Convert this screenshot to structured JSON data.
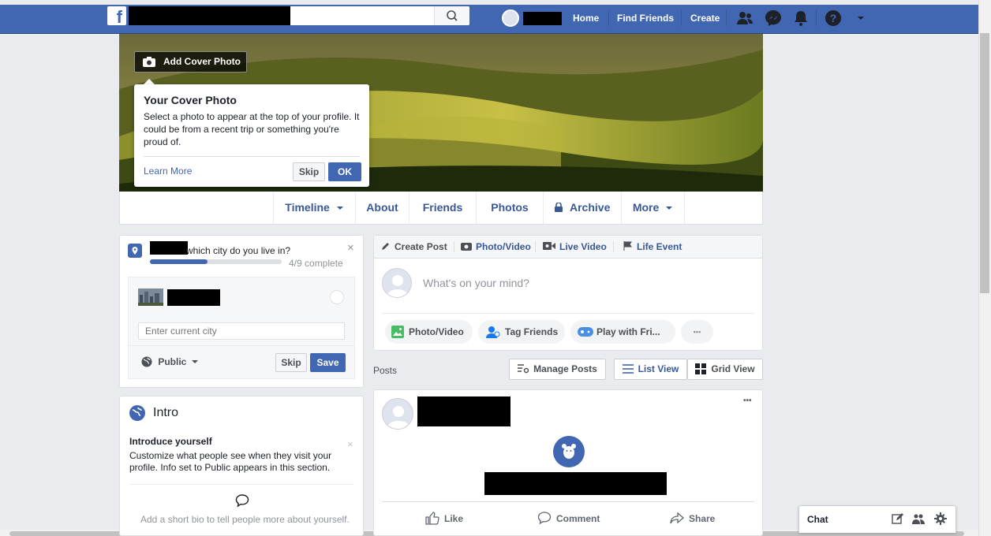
{
  "topbar": {
    "logo": "f",
    "home": "Home",
    "find_friends": "Find Friends",
    "create": "Create"
  },
  "cover": {
    "add_cover_label": "Add Cover Photo",
    "tooltip_title": "Your Cover Photo",
    "tooltip_body": "Select a photo to appear at the top of your profile. It could be from a recent trip or something you're proud of.",
    "learn_more": "Learn More",
    "skip": "Skip",
    "ok": "OK"
  },
  "tabs": {
    "timeline": "Timeline",
    "about": "About",
    "friends": "Friends",
    "photos": "Photos",
    "archive": "Archive",
    "more": "More"
  },
  "city": {
    "question": "which city do you live in?",
    "progress_text": "4/9 complete",
    "progress": 0.44,
    "input_placeholder": "Enter current city",
    "privacy": "Public",
    "skip": "Skip",
    "save": "Save"
  },
  "composer": {
    "create_post": "Create Post",
    "photo_video": "Photo/Video",
    "live_video": "Live Video",
    "life_event": "Life Event",
    "placeholder": "What's on your mind?",
    "pill_photo": "Photo/Video",
    "pill_tag": "Tag Friends",
    "pill_play": "Play with Fri...",
    "pill_more": "•••"
  },
  "posts_bar": {
    "label": "Posts",
    "manage": "Manage Posts",
    "list_view": "List View",
    "grid_view": "Grid View"
  },
  "intro": {
    "title": "Intro",
    "introduce": "Introduce yourself",
    "body": "Customize what people see when they visit your profile. Info set to Public appears in this section.",
    "bio_hint": "Add a short bio to tell people more about yourself."
  },
  "feed_post": {
    "more": "•••",
    "like": "Like",
    "comment": "Comment",
    "share": "Share"
  },
  "chat": {
    "label": "Chat"
  },
  "colors": {
    "brand": "#4267b2",
    "link": "#385898",
    "background": "#e9ebee"
  }
}
